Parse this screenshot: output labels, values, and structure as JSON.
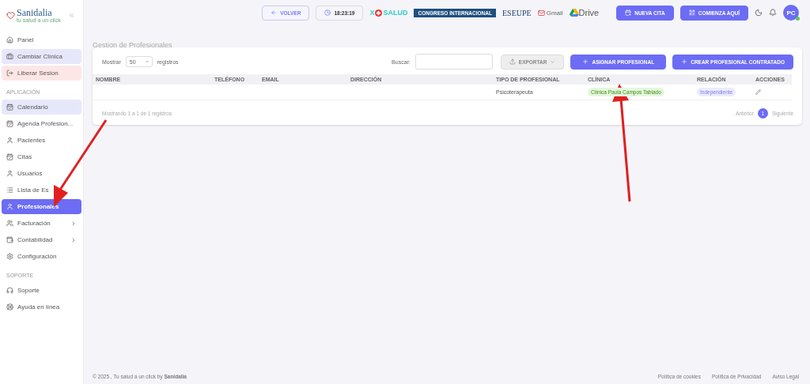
{
  "brand": {
    "name": "Sanidalia",
    "tagline": "tu salud a un click"
  },
  "sidebar": {
    "items": [
      {
        "kind": "link",
        "label": "Panel",
        "selected": false,
        "expandable": false
      },
      {
        "kind": "soft",
        "label": "Cambiar Clínica",
        "selected": false,
        "expandable": false
      },
      {
        "kind": "danger",
        "label": "Liberar Sesion",
        "selected": false,
        "expandable": false
      },
      {
        "kind": "section",
        "label": "APLICACIÓN"
      },
      {
        "kind": "soft",
        "label": "Calendario",
        "selected": false,
        "expandable": false
      },
      {
        "kind": "link",
        "label": "Agenda Profesion...",
        "selected": false,
        "expandable": false
      },
      {
        "kind": "link",
        "label": "Pacientes",
        "selected": false,
        "expandable": false
      },
      {
        "kind": "link",
        "label": "Citas",
        "selected": false,
        "expandable": false
      },
      {
        "kind": "link",
        "label": "Usuarios",
        "selected": false,
        "expandable": false
      },
      {
        "kind": "link",
        "label": "Lista de Es",
        "selected": false,
        "expandable": false
      },
      {
        "kind": "link",
        "label": "Profesionales",
        "selected": true,
        "expandable": false
      },
      {
        "kind": "link",
        "label": "Facturación",
        "selected": false,
        "expandable": true
      },
      {
        "kind": "link",
        "label": "Contabilidad",
        "selected": false,
        "expandable": true
      },
      {
        "kind": "link",
        "label": "Configuración",
        "selected": false,
        "expandable": false
      },
      {
        "kind": "section",
        "label": "SOPORTE"
      },
      {
        "kind": "link",
        "label": "Soporte",
        "selected": false,
        "expandable": false
      },
      {
        "kind": "link",
        "label": "Ayuda en línea",
        "selected": false,
        "expandable": false
      }
    ]
  },
  "topbar": {
    "back": "VOLVER",
    "time": "18:23:19",
    "logos": [
      {
        "kind": "xo",
        "text": "X",
        "text2": "SALUD"
      },
      {
        "kind": "congreso",
        "text": "CONGRESO INTERNACIONAL"
      },
      {
        "kind": "eseupe",
        "text": "ESEUPE"
      },
      {
        "kind": "gmail",
        "text": "Gmail"
      },
      {
        "kind": "drive",
        "text": "Drive"
      }
    ],
    "new_appointment": "NUEVA CITA",
    "start_here": "COMIENZA AQUÍ",
    "avatar": "PC"
  },
  "page_title": "Gestion de Profesionales",
  "table": {
    "show_label": "Mostrar",
    "page_size": "50",
    "records_label": "registros",
    "search_label": "Buscar:",
    "export": "EXPORTAR",
    "assign": "ASIGNAR PROFESIONAL",
    "create": "CREAR PROFESIONAL CONTRATADO",
    "columns": [
      "NOMBRE",
      "TELÉFONO",
      "EMAIL",
      "DIRECCIÓN",
      "TIPO DE PROFESIONAL",
      "CLÍNICA",
      "RELACIÓN",
      "ACCIONES"
    ],
    "rows": [
      {
        "type": "Psicoterapeuta",
        "clinic": "Clínica Paula Campos Tablado",
        "relation": "Independiente"
      }
    ],
    "info": "Mostrando 1 a 1 de 1 registros",
    "prev": "Anterior",
    "page": "1",
    "next": "Siguiente"
  },
  "footer": {
    "copyright": "© 2025 , Tu salud a un click by **Sanidalia**",
    "links": [
      "Política de cookies",
      "Política de Privacidad",
      "Aviso Legal"
    ]
  }
}
